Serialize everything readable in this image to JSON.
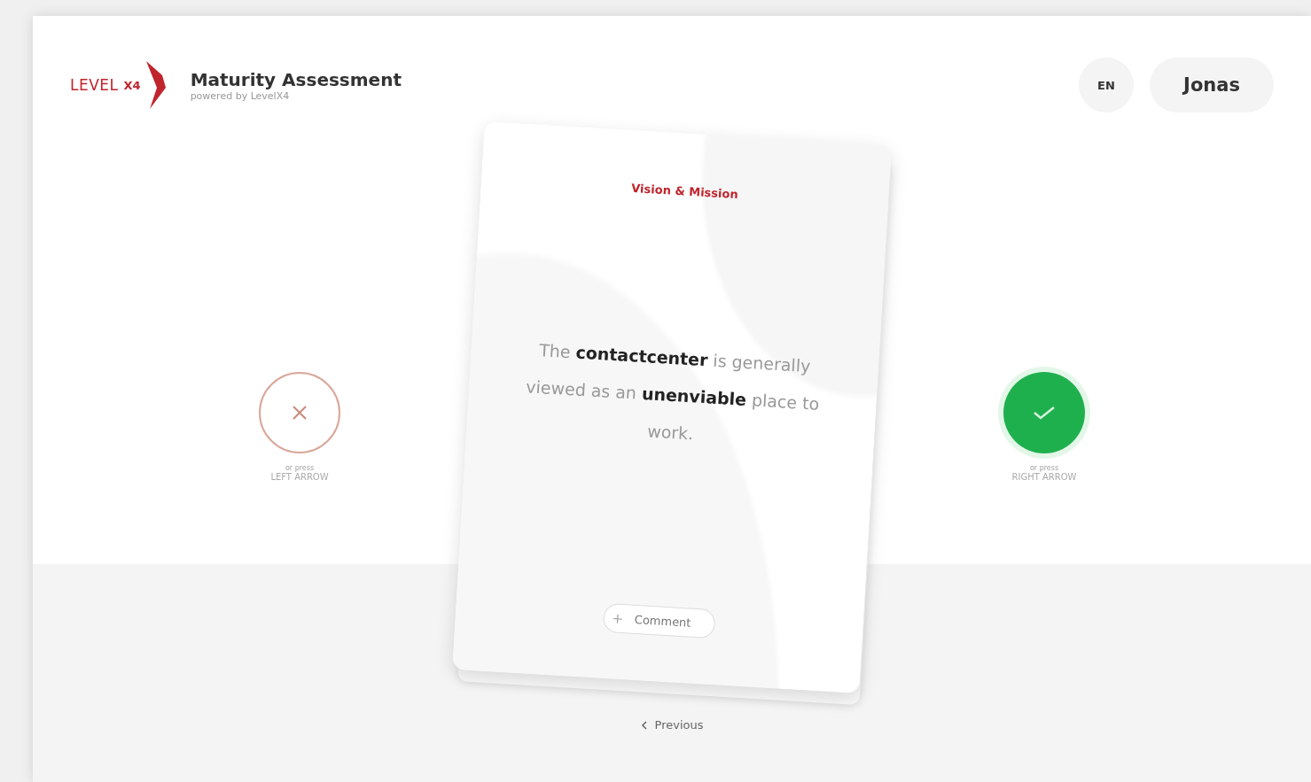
{
  "header": {
    "logo_word": "LEVEL",
    "logo_mark": "X4",
    "title": "Maturity Assessment",
    "subtitle": "powered by LevelX4"
  },
  "language": {
    "label": "EN"
  },
  "user": {
    "name": "Jonas"
  },
  "card": {
    "category": "Vision & Mission",
    "statement": "The **contactcenter** is generally viewed as an **unenviable** place to work.",
    "comment_label": "Comment"
  },
  "answers": [
    {
      "kind": "reject",
      "hint": "or press",
      "key": "LEFT ARROW",
      "active": false
    },
    {
      "kind": "accept",
      "hint": "or press",
      "key": "RIGHT ARROW",
      "active": true
    }
  ],
  "previous": {
    "label": "Previous"
  }
}
